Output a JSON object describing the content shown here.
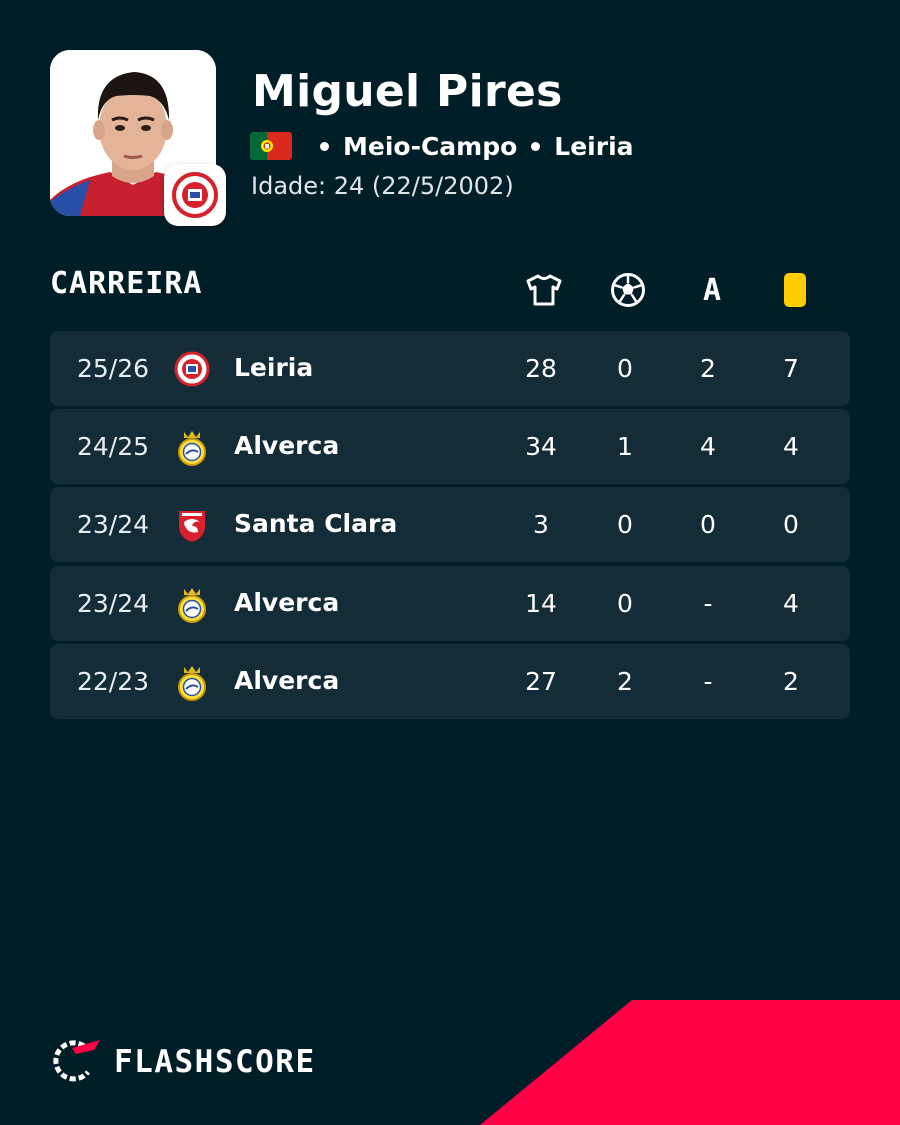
{
  "player": {
    "name": "Miguel Pires",
    "position": "Meio-Campo",
    "club": "Leiria",
    "age_label": "Idade: 24  (22/5/2002)",
    "flag": "portugal-flag"
  },
  "career": {
    "title": "CARREIRA",
    "columns": [
      {
        "icon": "jersey-icon"
      },
      {
        "icon": "ball-icon"
      },
      {
        "label": "A"
      },
      {
        "icon": "yellow-card-icon"
      }
    ],
    "rows": [
      {
        "season": "25/26",
        "team": "Leiria",
        "crest": "leiria-crest",
        "apps": "28",
        "goals": "0",
        "assists": "2",
        "cards": "7"
      },
      {
        "season": "24/25",
        "team": "Alverca",
        "crest": "alverca-crest",
        "apps": "34",
        "goals": "1",
        "assists": "4",
        "cards": "4"
      },
      {
        "season": "23/24",
        "team": "Santa Clara",
        "crest": "santa-clara-crest",
        "apps": "3",
        "goals": "0",
        "assists": "0",
        "cards": "0"
      },
      {
        "season": "23/24",
        "team": "Alverca",
        "crest": "alverca-crest",
        "apps": "14",
        "goals": "0",
        "assists": "-",
        "cards": "4"
      },
      {
        "season": "22/23",
        "team": "Alverca",
        "crest": "alverca-crest",
        "apps": "27",
        "goals": "2",
        "assists": "-",
        "cards": "2"
      }
    ]
  },
  "brand": {
    "name": "FLASHSCORE",
    "accent_color": "#ff0046",
    "background_color": "#001e28",
    "row_color": "#132c37",
    "card_color": "#ffcd00"
  }
}
